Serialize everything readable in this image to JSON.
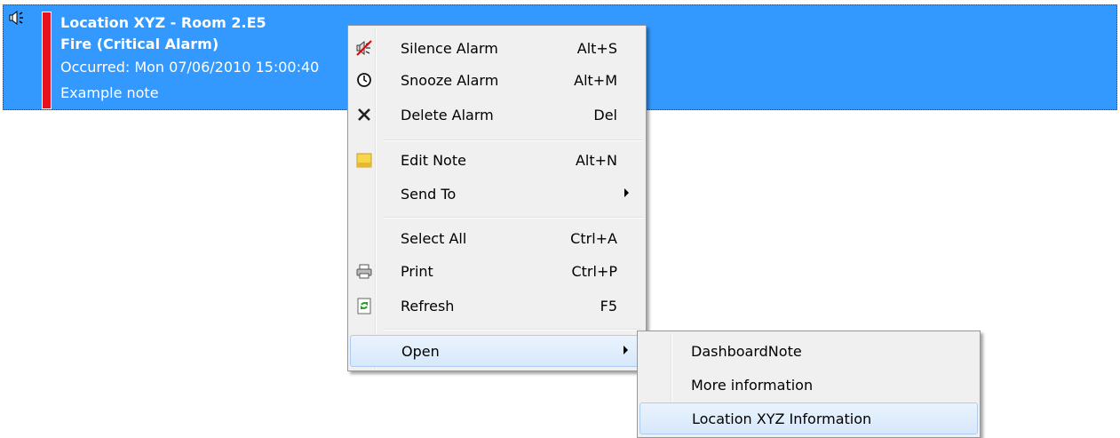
{
  "alarm": {
    "location": "Location XYZ - Room 2.E5",
    "type": "Fire  (Critical Alarm)",
    "occurred": "Occurred: Mon 07/06/2010 15:00:40",
    "note": "Example note",
    "row_color": "#3399ff",
    "severity_color": "#e8121c"
  },
  "context_menu": {
    "items": [
      {
        "label": "Silence Alarm",
        "accel": "Alt+S",
        "icon": "speaker-muted-icon"
      },
      {
        "label": "Snooze Alarm",
        "accel": "Alt+M",
        "icon": "clock-icon"
      },
      {
        "label": "Delete Alarm",
        "accel": "Del",
        "icon": "delete-x-icon"
      },
      {
        "label": "Edit Note",
        "accel": "Alt+N",
        "icon": "sticky-note-icon"
      },
      {
        "label": "Send To",
        "accel": "",
        "icon": ""
      },
      {
        "label": "Select All",
        "accel": "Ctrl+A",
        "icon": ""
      },
      {
        "label": "Print",
        "accel": "Ctrl+P",
        "icon": "printer-icon"
      },
      {
        "label": "Refresh",
        "accel": "F5",
        "icon": "refresh-icon"
      },
      {
        "label": "Open",
        "accel": "",
        "icon": ""
      }
    ]
  },
  "open_submenu": {
    "items": [
      {
        "label": "DashboardNote"
      },
      {
        "label": "More information"
      },
      {
        "label": "Location XYZ Information"
      }
    ]
  }
}
